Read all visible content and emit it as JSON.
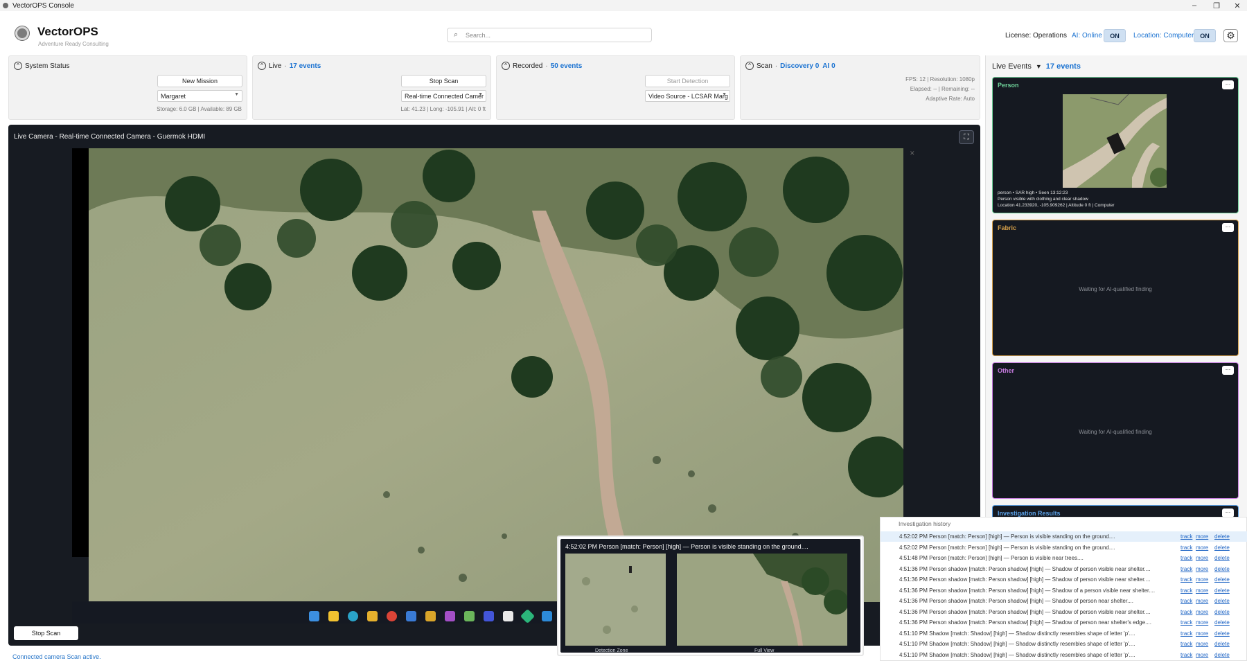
{
  "window": {
    "title": "VectorOPS Console"
  },
  "header": {
    "brand": "VectorOPS",
    "subbrand": "Adventure Ready Consulting",
    "search_placeholder": "Search...",
    "license": "License: Operations",
    "ai_status": "AI: Online",
    "ai_toggle": "ON",
    "location_status": "Location: Computer",
    "location_toggle": "ON"
  },
  "panels": {
    "system": {
      "title": "System Status",
      "button": "New Mission",
      "select": "Margaret",
      "meta": "Storage: 6.0 GB | Available: 89 GB"
    },
    "live": {
      "title": "Live",
      "count": "17 events",
      "button": "Stop Scan",
      "select": "Real-time Connected Camer",
      "meta": "Lat: 41.23 | Long: -105.91 | Alt: 0 ft"
    },
    "recorded": {
      "title": "Recorded",
      "count": "50 events",
      "button": "Start Detection",
      "select": "Video Source - LCSAR Marg"
    },
    "scan": {
      "title": "Scan",
      "discovery": "Discovery 0",
      "ai": "AI 0",
      "meta1": "FPS: 12 | Resolution: 1080p",
      "meta2": "Elapsed: -- | Remaining: --",
      "meta3": "Adaptive Rate: Auto"
    }
  },
  "live_view": {
    "title": "Live Camera - Real-time Connected Camera - Guermok HDMI",
    "stop_button": "Stop Scan",
    "status": "Connected camera Scan active."
  },
  "live_events": {
    "title": "Live Events",
    "count": "17 events",
    "cards": [
      {
        "label": "Person",
        "color": "#6fd29a",
        "line1": "person • SAR high • Seen 13:12:23",
        "line2": "Person visible with clothing and clear shadow",
        "line3": "Location 41.233920, -105.909262 | Altitude 0 ft | Computer"
      },
      {
        "label": "Fabric",
        "color": "#d9a24a",
        "waiting": "Waiting for AI-qualified finding"
      },
      {
        "label": "Other",
        "color": "#c77be0",
        "waiting": "Waiting for AI-qualified finding"
      },
      {
        "label": "Investigation Results",
        "color": "#5aa0e6"
      }
    ],
    "more_label": "..."
  },
  "popup": {
    "text": "4:52:02 PM  Person  [match: Person]  [high] — Person is visible standing on the ground....",
    "caption_left": "Detection Zone",
    "caption_right": "Full View"
  },
  "history": {
    "title": "Investigation history",
    "links": {
      "track": "track",
      "more": "more",
      "delete": "delete"
    },
    "rows": [
      "4:52:02 PM  Person  [match: Person]  [high] — Person is visible standing on the ground....",
      "4:52:02 PM  Person  [match: Person]  [high] — Person is visible standing on the ground....",
      "4:51:48 PM  Person  [match: Person]  [high] — Person is visible near trees....",
      "4:51:36 PM  Person shadow  [match: Person shadow]  [high] — Shadow of person visible near shelter....",
      "4:51:36 PM  Person shadow  [match: Person shadow]  [high] — Shadow of person visible near shelter....",
      "4:51:36 PM  Person shadow  [match: Person shadow]  [high] — Shadow of a person visible near shelter....",
      "4:51:36 PM  Person shadow  [match: Person shadow]  [high] — Shadow of person near shelter....",
      "4:51:36 PM  Person shadow  [match: Person shadow]  [high] — Shadow of person visible near shelter....",
      "4:51:36 PM  Person shadow  [match: Person shadow]  [high] — Shadow of person near shelter's edge....",
      "4:51:10 PM  Shadow  [match: Shadow]  [high] — Shadow distinctly resembles shape of letter 'p'....",
      "4:51:10 PM  Shadow  [match: Shadow]  [high] — Shadow distinctly resembles shape of letter 'p'....",
      "4:51:10 PM  Shadow  [match: Shadow]  [high] — Shadow distinctly resembles shape of letter 'p'...."
    ]
  },
  "colors": {
    "accent": "#1a72d1",
    "dark_panel": "#151921"
  }
}
